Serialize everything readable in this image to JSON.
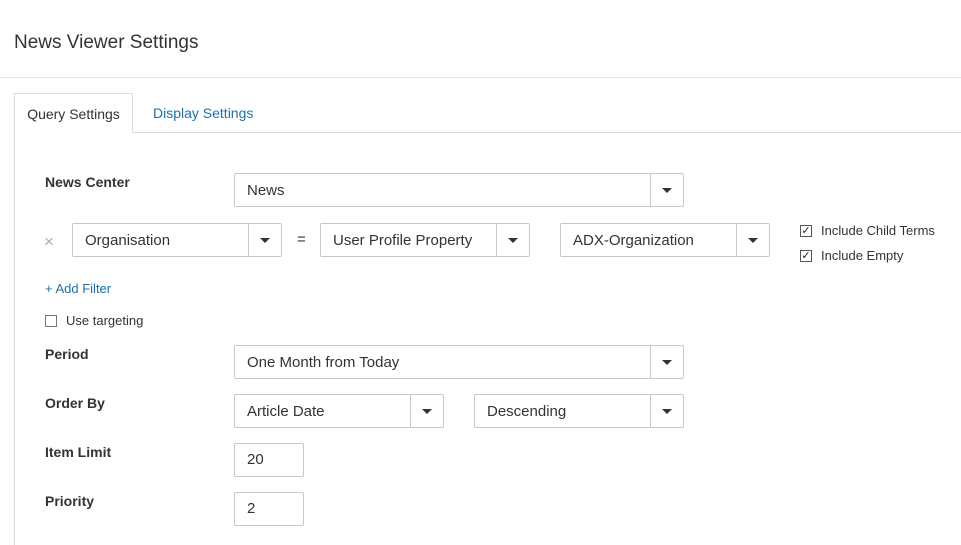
{
  "page": {
    "title": "News Viewer Settings"
  },
  "tabs": [
    {
      "label": "Query Settings",
      "active": true
    },
    {
      "label": "Display Settings",
      "active": false
    }
  ],
  "query": {
    "news_center": {
      "label": "News Center",
      "value": "News"
    },
    "filter": {
      "field": "Organisation",
      "operator": "=",
      "source": "User Profile Property",
      "property": "ADX-Organization",
      "include_child_terms": {
        "label": "Include Child Terms",
        "checked": true
      },
      "include_empty": {
        "label": "Include Empty",
        "checked": true
      }
    },
    "add_filter_label": "+ Add Filter",
    "use_targeting": {
      "label": "Use targeting",
      "checked": false
    },
    "period": {
      "label": "Period",
      "value": "One Month from Today"
    },
    "order_by": {
      "label": "Order By",
      "field": "Article Date",
      "direction": "Descending"
    },
    "item_limit": {
      "label": "Item Limit",
      "value": "20"
    },
    "priority": {
      "label": "Priority",
      "value": "2"
    }
  },
  "icons": {
    "remove": "close-icon",
    "caret": "chevron-down-icon",
    "check": "checkmark-icon"
  }
}
